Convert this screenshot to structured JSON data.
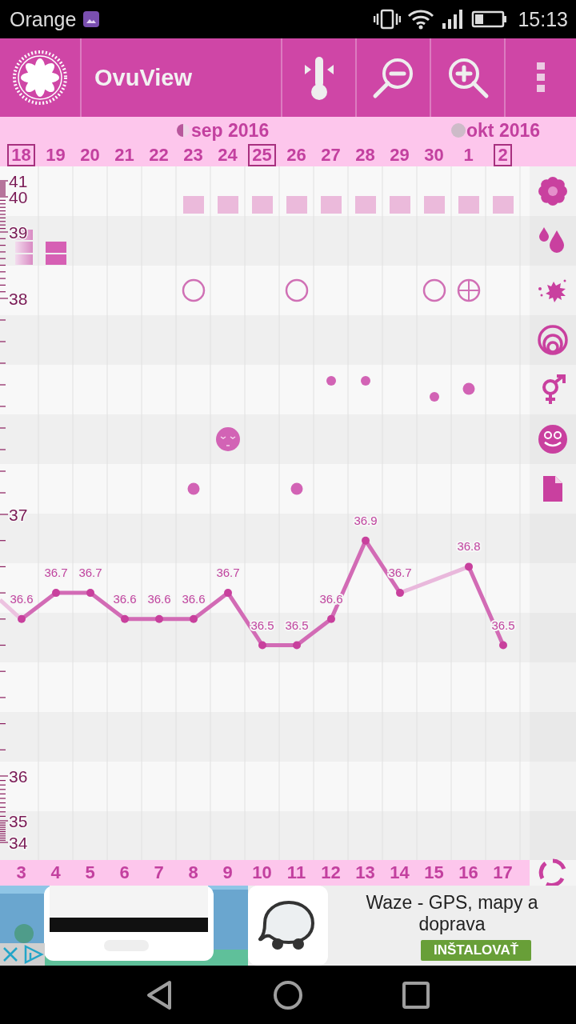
{
  "status_bar": {
    "carrier": "Orange",
    "time": "15:13"
  },
  "app_bar": {
    "title": "OvuView"
  },
  "calendar_header": {
    "days": [
      {
        "label": "18",
        "marked": true
      },
      {
        "label": "19",
        "marked": false
      },
      {
        "label": "20",
        "marked": false
      },
      {
        "label": "21",
        "marked": false
      },
      {
        "label": "22",
        "marked": false
      },
      {
        "label": "23",
        "marked": false,
        "month": {
          "label": "sep 2016",
          "kind": "half-moon"
        }
      },
      {
        "label": "24",
        "marked": false
      },
      {
        "label": "25",
        "marked": true
      },
      {
        "label": "26",
        "marked": false
      },
      {
        "label": "27",
        "marked": false
      },
      {
        "label": "28",
        "marked": false
      },
      {
        "label": "29",
        "marked": false
      },
      {
        "label": "30",
        "marked": false
      },
      {
        "label": "1",
        "marked": false,
        "month": {
          "label": "okt 2016",
          "kind": "full-moon"
        }
      },
      {
        "label": "2",
        "marked": true
      }
    ]
  },
  "tracks": [
    {
      "kind": "flower",
      "cells": [
        {
          "kind": "none"
        },
        {
          "kind": "none"
        },
        {
          "kind": "none"
        },
        {
          "kind": "none"
        },
        {
          "kind": "none"
        },
        {
          "kind": "square"
        },
        {
          "kind": "square"
        },
        {
          "kind": "square"
        },
        {
          "kind": "square"
        },
        {
          "kind": "square"
        },
        {
          "kind": "square"
        },
        {
          "kind": "square"
        },
        {
          "kind": "square"
        },
        {
          "kind": "square"
        },
        {
          "kind": "square"
        }
      ]
    },
    {
      "kind": "drops",
      "cells": [
        {
          "kind": "bars3"
        },
        {
          "kind": "bars2"
        },
        {
          "kind": "none"
        },
        {
          "kind": "none"
        },
        {
          "kind": "none"
        },
        {
          "kind": "none"
        },
        {
          "kind": "none"
        },
        {
          "kind": "none"
        },
        {
          "kind": "none"
        },
        {
          "kind": "none"
        },
        {
          "kind": "none"
        },
        {
          "kind": "none"
        },
        {
          "kind": "none"
        },
        {
          "kind": "none"
        },
        {
          "kind": "none"
        }
      ]
    },
    {
      "kind": "splash",
      "cells": [
        {
          "kind": "none"
        },
        {
          "kind": "none"
        },
        {
          "kind": "none"
        },
        {
          "kind": "none"
        },
        {
          "kind": "none"
        },
        {
          "kind": "ring"
        },
        {
          "kind": "none"
        },
        {
          "kind": "none"
        },
        {
          "kind": "ring"
        },
        {
          "kind": "none"
        },
        {
          "kind": "none"
        },
        {
          "kind": "none"
        },
        {
          "kind": "ring"
        },
        {
          "kind": "crossring"
        },
        {
          "kind": "none"
        }
      ]
    },
    {
      "kind": "rings",
      "cells": [
        {
          "kind": "none"
        },
        {
          "kind": "none"
        },
        {
          "kind": "none"
        },
        {
          "kind": "none"
        },
        {
          "kind": "none"
        },
        {
          "kind": "none"
        },
        {
          "kind": "none"
        },
        {
          "kind": "none"
        },
        {
          "kind": "none"
        },
        {
          "kind": "none"
        },
        {
          "kind": "none"
        },
        {
          "kind": "none"
        },
        {
          "kind": "none"
        },
        {
          "kind": "none"
        },
        {
          "kind": "none"
        }
      ]
    },
    {
      "kind": "gender",
      "cells": [
        {
          "kind": "none"
        },
        {
          "kind": "none"
        },
        {
          "kind": "none"
        },
        {
          "kind": "none"
        },
        {
          "kind": "none"
        },
        {
          "kind": "none"
        },
        {
          "kind": "none"
        },
        {
          "kind": "none"
        },
        {
          "kind": "none"
        },
        {
          "kind": "high"
        },
        {
          "kind": "high"
        },
        {
          "kind": "none"
        },
        {
          "kind": "low"
        },
        {
          "kind": "large"
        },
        {
          "kind": "none"
        }
      ]
    },
    {
      "kind": "smiley",
      "cells": [
        {
          "kind": "none"
        },
        {
          "kind": "none"
        },
        {
          "kind": "none"
        },
        {
          "kind": "none"
        },
        {
          "kind": "none"
        },
        {
          "kind": "none"
        },
        {
          "kind": "face"
        },
        {
          "kind": "none"
        },
        {
          "kind": "none"
        },
        {
          "kind": "none"
        },
        {
          "kind": "none"
        },
        {
          "kind": "none"
        },
        {
          "kind": "none"
        },
        {
          "kind": "none"
        },
        {
          "kind": "none"
        }
      ]
    },
    {
      "kind": "document",
      "cells": [
        {
          "kind": "none"
        },
        {
          "kind": "none"
        },
        {
          "kind": "none"
        },
        {
          "kind": "none"
        },
        {
          "kind": "none"
        },
        {
          "kind": "dot"
        },
        {
          "kind": "none"
        },
        {
          "kind": "none"
        },
        {
          "kind": "dot"
        },
        {
          "kind": "none"
        },
        {
          "kind": "none"
        },
        {
          "kind": "none"
        },
        {
          "kind": "none"
        },
        {
          "kind": "none"
        },
        {
          "kind": "none"
        }
      ]
    }
  ],
  "chart_data": {
    "type": "line",
    "categories": [
      "3",
      "4",
      "5",
      "6",
      "7",
      "8",
      "9",
      "10",
      "11",
      "12",
      "13",
      "14",
      "15",
      "16",
      "17"
    ],
    "series": [
      {
        "color": "#d26bb5",
        "marker": true,
        "values": [
          36.6,
          36.7,
          36.7,
          36.6,
          36.6,
          36.6,
          36.7,
          36.5,
          36.5,
          36.6,
          36.9,
          36.7,
          null,
          36.8,
          36.5
        ]
      }
    ],
    "data_labels": true
  },
  "temperature_axis": {
    "labels": [
      "41",
      "40",
      "39",
      "38",
      "37",
      "36",
      "35",
      "34"
    ]
  },
  "ad": {
    "title": "Waze - GPS, mapy a doprava",
    "button": "INŠTALOVAŤ"
  }
}
